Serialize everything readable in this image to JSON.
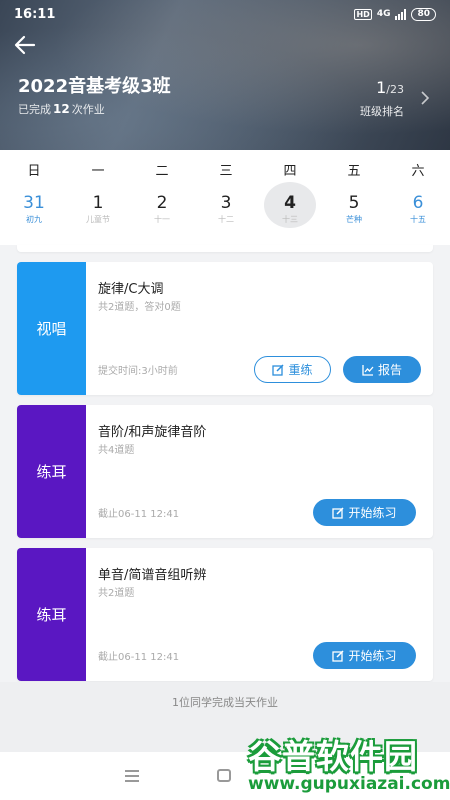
{
  "status_bar": {
    "time": "16:11",
    "hd": "HD",
    "network": "4G",
    "battery": "80"
  },
  "header": {
    "title": "2022音基考级3班",
    "completed_prefix": "已完成",
    "completed_count": "12",
    "completed_suffix": "次作业",
    "rank_current": "1",
    "rank_total": "/23",
    "rank_label": "班级排名"
  },
  "calendar": {
    "weekdays": [
      "日",
      "一",
      "二",
      "三",
      "四",
      "五",
      "六"
    ],
    "dates": [
      {
        "day": "31",
        "sub": "初九"
      },
      {
        "day": "1",
        "sub": "儿童节"
      },
      {
        "day": "2",
        "sub": "十一"
      },
      {
        "day": "3",
        "sub": "十二"
      },
      {
        "day": "4",
        "sub": "十三"
      },
      {
        "day": "5",
        "sub": "芒种"
      },
      {
        "day": "6",
        "sub": "十五"
      }
    ]
  },
  "cards": [
    {
      "tag": "视唱",
      "title": "旋律/C大调",
      "info": "共2道题，答对0题",
      "footer": "提交时间:3小时前",
      "btn_redo": "重练",
      "btn_report": "报告"
    },
    {
      "tag": "练耳",
      "title": "音阶/和声旋律音阶",
      "info": "共4道题",
      "footer": "截止06-11 12:41",
      "btn_start": "开始练习"
    },
    {
      "tag": "练耳",
      "title": "单音/简谱音组听辨",
      "info": "共2道题",
      "footer": "截止06-11 12:41",
      "btn_start": "开始练习"
    }
  ],
  "footer_note": "1位同学完成当天作业",
  "watermark": {
    "brand": "谷普软件园",
    "url": "www.gupuxiazai.com"
  },
  "colors": {
    "accent": "#2d8fdc",
    "tag_blue": "#1e9af0",
    "tag_purple": "#5a17c2"
  }
}
